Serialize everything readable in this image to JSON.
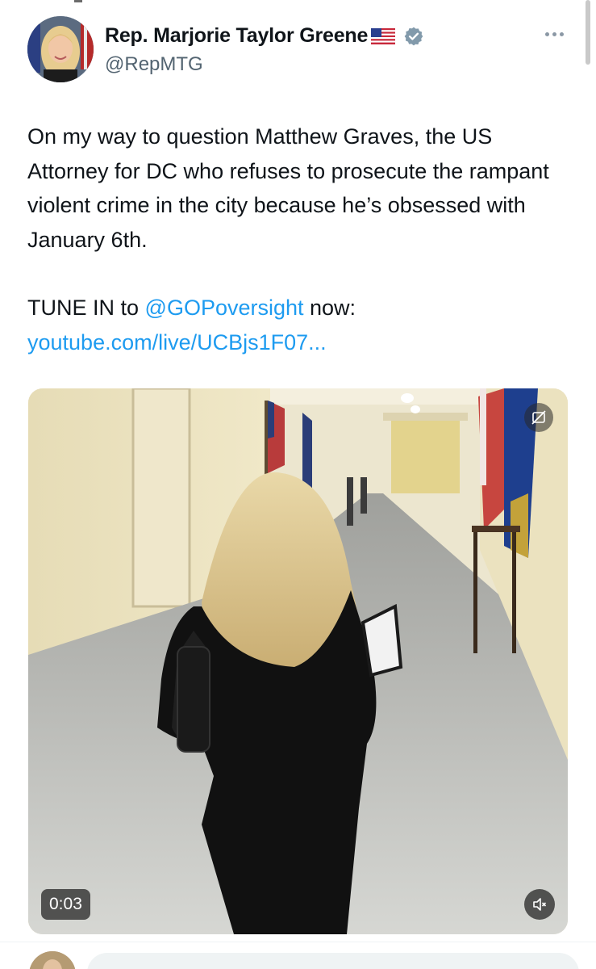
{
  "tweet": {
    "author": {
      "display_name": "Rep. Marjorie Taylor Greene",
      "handle": "@RepMTG",
      "flag_icon": "us-flag-emoji",
      "verified_icon": "verified-badge-icon",
      "verified_color": "#829aab"
    },
    "more_icon": "more-horizontal-icon",
    "text": {
      "paragraph1": "On my way to question Matthew Graves, the US Attorney for DC who refuses to prosecute the rampant violent crime in the city because he’s obsessed with January 6th.",
      "tune_in_prefix": "TUNE IN to ",
      "mention": "@GOPoversight",
      "now_text": " now: ",
      "url_text": "youtube.com/live/UCBjs1F07..."
    },
    "video": {
      "timestamp": "0:03",
      "captions_icon": "captions-off-icon",
      "mute_icon": "speaker-muted-icon"
    }
  },
  "colors": {
    "link": "#1d9bf0",
    "text": "#0f1419",
    "secondary": "#536471"
  }
}
